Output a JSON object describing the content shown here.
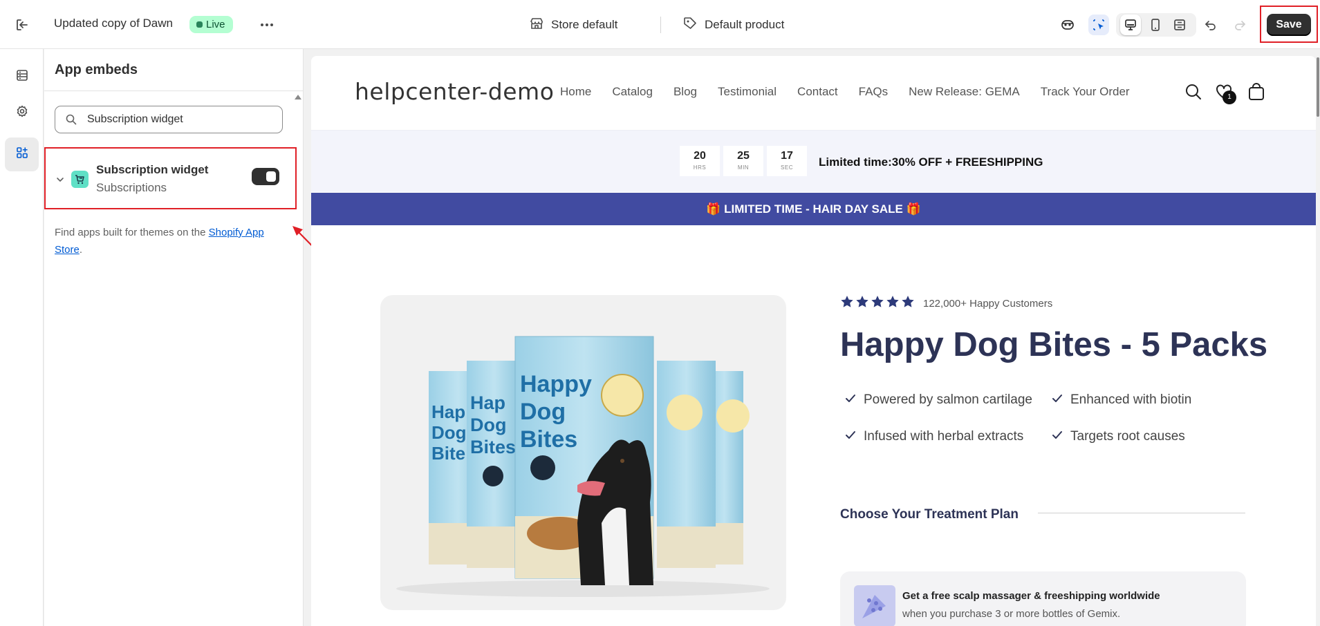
{
  "topbar": {
    "theme_name": "Updated copy of Dawn",
    "live_badge": "Live",
    "store_selector": "Store default",
    "template_selector": "Default product",
    "save_label": "Save"
  },
  "panel": {
    "title": "App embeds",
    "search": {
      "value": "Subscription widget",
      "placeholder": "Search"
    },
    "embed": {
      "name": "Subscription widget",
      "app": "Subscriptions",
      "enabled": true
    },
    "hint_prefix": "Find apps built for themes on the ",
    "hint_link": "Shopify App Store",
    "hint_suffix": "."
  },
  "preview": {
    "logo": "helpcenter-demo",
    "nav": [
      "Home",
      "Catalog",
      "Blog",
      "Testimonial",
      "Contact",
      "FAQs",
      "New Release: GEMA",
      "Track Your Order"
    ],
    "wishlist_count": "1",
    "countdown": [
      {
        "value": "20",
        "unit": "HRS"
      },
      {
        "value": "25",
        "unit": "MIN"
      },
      {
        "value": "17",
        "unit": "SEC"
      }
    ],
    "countdown_text": "Limited time:30% OFF + FREESHIPPING",
    "promo_banner": "🎁 LIMITED TIME - HAIR DAY SALE 🎁",
    "product": {
      "rating": 5,
      "rating_text": "122,000+ Happy Customers",
      "title": "Happy Dog Bites - 5 Packs",
      "benefits": [
        "Powered by salmon cartilage",
        "Enhanced with biotin",
        "Infused with herbal extracts",
        "Targets root causes"
      ],
      "plan_heading": "Choose Your Treatment Plan",
      "offer_title": "Get a free scalp massager & freeshipping worldwide",
      "offer_sub": "when you purchase 3 or more bottles of Gemix.",
      "bag_text": [
        "Happy",
        "Dog",
        "Bites"
      ],
      "bag_short": [
        "Hap",
        "Dog",
        "Bite"
      ]
    }
  },
  "colors": {
    "accent_red": "#e01f26",
    "brand_navy": "#2d3356",
    "promo_blue": "#414ba1",
    "live_green": "#b4fed2"
  }
}
